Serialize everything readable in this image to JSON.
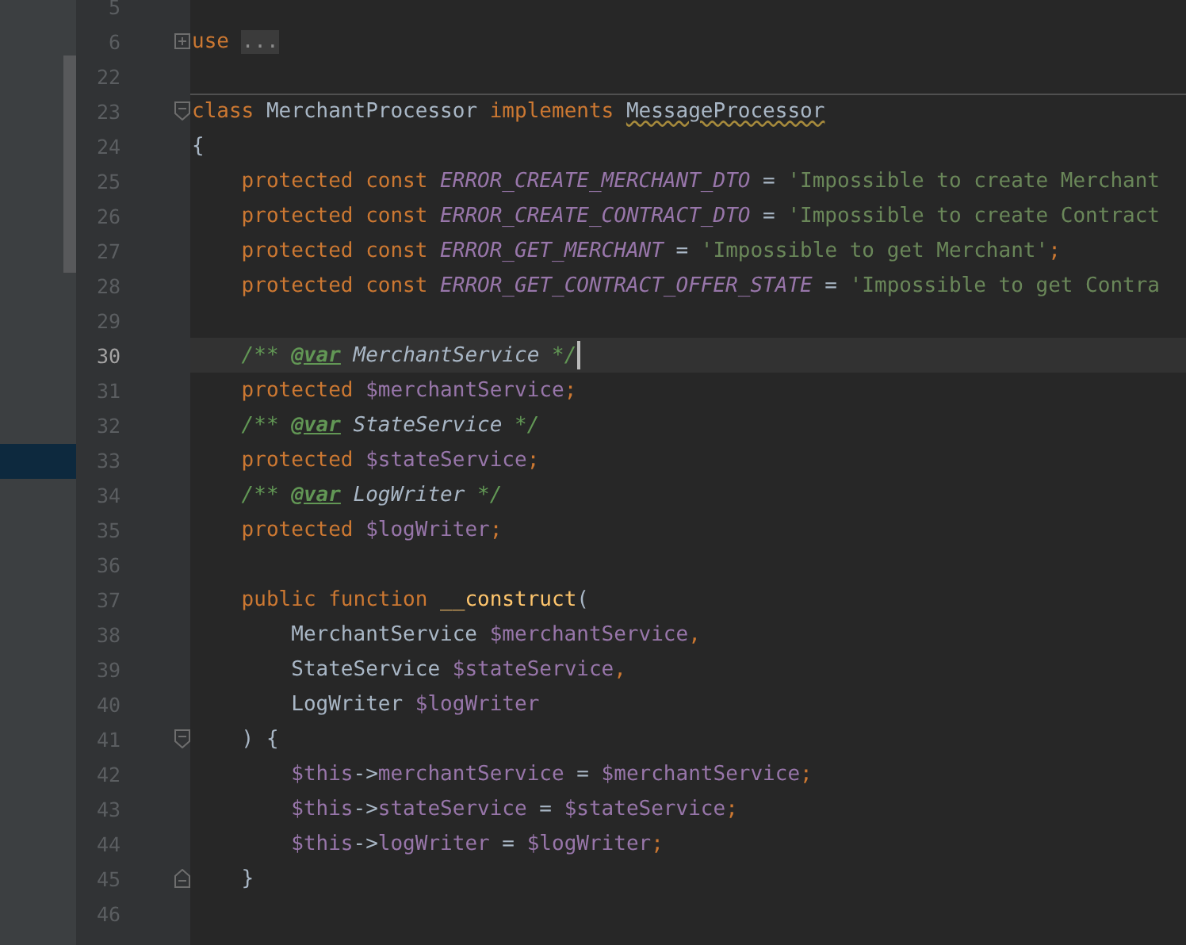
{
  "editor": {
    "lines": [
      {
        "number": "5",
        "current": false,
        "kind": "plain"
      },
      {
        "number": "6",
        "current": false,
        "kind": "fold-collapsed",
        "code": [
          {
            "kind": "kw",
            "text": "use "
          },
          {
            "kind": "folded",
            "text": "..."
          }
        ]
      },
      {
        "number": "22",
        "current": false,
        "kind": "plain"
      },
      {
        "number": "23",
        "current": false,
        "kind": "fold-start",
        "separator": true,
        "code": [
          {
            "kind": "kw",
            "text": "class "
          },
          {
            "kind": "plain",
            "text": "MerchantProcessor "
          },
          {
            "kind": "kw",
            "text": "implements "
          },
          {
            "kind": "warn",
            "text": "MessageProcessor"
          }
        ]
      },
      {
        "number": "24",
        "current": false,
        "kind": "plain",
        "code": [
          {
            "kind": "plain",
            "text": "{"
          }
        ]
      },
      {
        "number": "25",
        "current": false,
        "kind": "plain",
        "code": [
          {
            "kind": "kw",
            "text": "    protected const "
          },
          {
            "kind": "const",
            "text": "ERROR_CREATE_MERCHANT_DTO"
          },
          {
            "kind": "plain",
            "text": " = "
          },
          {
            "kind": "str",
            "text": "'Impossible to create Merchant"
          }
        ]
      },
      {
        "number": "26",
        "current": false,
        "kind": "plain",
        "code": [
          {
            "kind": "kw",
            "text": "    protected const "
          },
          {
            "kind": "const",
            "text": "ERROR_CREATE_CONTRACT_DTO"
          },
          {
            "kind": "plain",
            "text": " = "
          },
          {
            "kind": "str",
            "text": "'Impossible to create Contract"
          }
        ]
      },
      {
        "number": "27",
        "current": false,
        "kind": "plain",
        "code": [
          {
            "kind": "kw",
            "text": "    protected const "
          },
          {
            "kind": "const",
            "text": "ERROR_GET_MERCHANT"
          },
          {
            "kind": "plain",
            "text": " = "
          },
          {
            "kind": "str",
            "text": "'Impossible to get Merchant'"
          },
          {
            "kind": "kw",
            "text": ";"
          }
        ]
      },
      {
        "number": "28",
        "current": false,
        "kind": "plain",
        "code": [
          {
            "kind": "kw",
            "text": "    protected const "
          },
          {
            "kind": "const",
            "text": "ERROR_GET_CONTRACT_OFFER_STATE"
          },
          {
            "kind": "plain",
            "text": " = "
          },
          {
            "kind": "str",
            "text": "'Impossible to get Contra"
          }
        ]
      },
      {
        "number": "29",
        "current": false,
        "kind": "plain"
      },
      {
        "number": "30",
        "current": true,
        "kind": "plain",
        "code": [
          {
            "kind": "comment",
            "text": "    /** "
          },
          {
            "kind": "tag",
            "text": "@var"
          },
          {
            "kind": "doctype",
            "text": " MerchantService "
          },
          {
            "kind": "comment",
            "text": "*/"
          }
        ]
      },
      {
        "number": "31",
        "current": false,
        "kind": "plain",
        "code": [
          {
            "kind": "kw",
            "text": "    protected "
          },
          {
            "kind": "var",
            "text": "$merchantService"
          },
          {
            "kind": "kw",
            "text": ";"
          }
        ]
      },
      {
        "number": "32",
        "current": false,
        "kind": "plain",
        "code": [
          {
            "kind": "comment",
            "text": "    /** "
          },
          {
            "kind": "tag",
            "text": "@var"
          },
          {
            "kind": "doctype",
            "text": " StateService "
          },
          {
            "kind": "comment",
            "text": "*/"
          }
        ]
      },
      {
        "number": "33",
        "current": false,
        "kind": "plain",
        "code": [
          {
            "kind": "kw",
            "text": "    protected "
          },
          {
            "kind": "var",
            "text": "$stateService"
          },
          {
            "kind": "kw",
            "text": ";"
          }
        ]
      },
      {
        "number": "34",
        "current": false,
        "kind": "plain",
        "code": [
          {
            "kind": "comment",
            "text": "    /** "
          },
          {
            "kind": "tag",
            "text": "@var"
          },
          {
            "kind": "doctype",
            "text": " LogWriter "
          },
          {
            "kind": "comment",
            "text": "*/"
          }
        ]
      },
      {
        "number": "35",
        "current": false,
        "kind": "plain",
        "code": [
          {
            "kind": "kw",
            "text": "    protected "
          },
          {
            "kind": "var",
            "text": "$logWriter"
          },
          {
            "kind": "kw",
            "text": ";"
          }
        ]
      },
      {
        "number": "36",
        "current": false,
        "kind": "plain"
      },
      {
        "number": "37",
        "current": false,
        "kind": "plain",
        "code": [
          {
            "kind": "kw",
            "text": "    public function "
          },
          {
            "kind": "fn",
            "text": "__construct"
          },
          {
            "kind": "plain",
            "text": "("
          }
        ]
      },
      {
        "number": "38",
        "current": false,
        "kind": "plain",
        "code": [
          {
            "kind": "plain",
            "text": "        MerchantService "
          },
          {
            "kind": "var",
            "text": "$merchantService"
          },
          {
            "kind": "kw",
            "text": ","
          }
        ]
      },
      {
        "number": "39",
        "current": false,
        "kind": "plain",
        "code": [
          {
            "kind": "plain",
            "text": "        StateService "
          },
          {
            "kind": "var",
            "text": "$stateService"
          },
          {
            "kind": "kw",
            "text": ","
          }
        ]
      },
      {
        "number": "40",
        "current": false,
        "kind": "plain",
        "code": [
          {
            "kind": "plain",
            "text": "        LogWriter "
          },
          {
            "kind": "var",
            "text": "$logWriter"
          }
        ]
      },
      {
        "number": "41",
        "current": false,
        "kind": "fold-start",
        "code": [
          {
            "kind": "plain",
            "text": "    ) {"
          }
        ]
      },
      {
        "number": "42",
        "current": false,
        "kind": "plain",
        "code": [
          {
            "kind": "var",
            "text": "        $this"
          },
          {
            "kind": "plain",
            "text": "->"
          },
          {
            "kind": "var",
            "text": "merchantService"
          },
          {
            "kind": "plain",
            "text": " = "
          },
          {
            "kind": "var",
            "text": "$merchantService"
          },
          {
            "kind": "kw",
            "text": ";"
          }
        ]
      },
      {
        "number": "43",
        "current": false,
        "kind": "plain",
        "code": [
          {
            "kind": "var",
            "text": "        $this"
          },
          {
            "kind": "plain",
            "text": "->"
          },
          {
            "kind": "var",
            "text": "stateService"
          },
          {
            "kind": "plain",
            "text": " = "
          },
          {
            "kind": "var",
            "text": "$stateService"
          },
          {
            "kind": "kw",
            "text": ";"
          }
        ]
      },
      {
        "number": "44",
        "current": false,
        "kind": "plain",
        "code": [
          {
            "kind": "var",
            "text": "        $this"
          },
          {
            "kind": "plain",
            "text": "->"
          },
          {
            "kind": "var",
            "text": "logWriter"
          },
          {
            "kind": "plain",
            "text": " = "
          },
          {
            "kind": "var",
            "text": "$logWriter"
          },
          {
            "kind": "kw",
            "text": ";"
          }
        ]
      },
      {
        "number": "45",
        "current": false,
        "kind": "fold-end",
        "code": [
          {
            "kind": "plain",
            "text": "    }"
          }
        ]
      },
      {
        "number": "46",
        "current": false,
        "kind": "plain"
      }
    ]
  }
}
